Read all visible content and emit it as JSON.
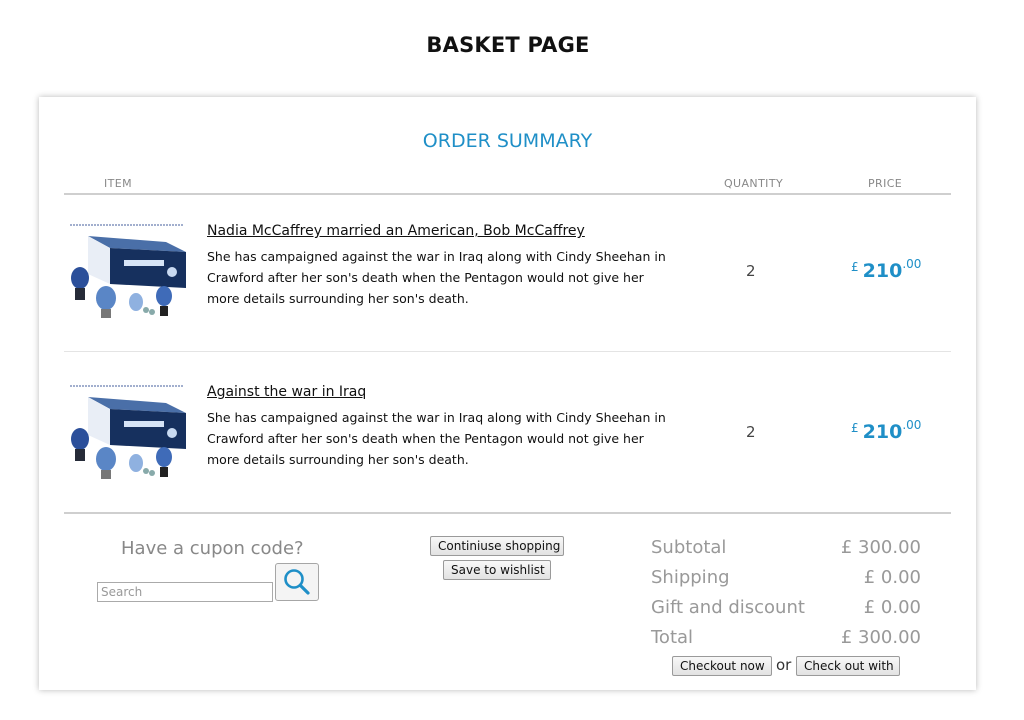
{
  "page": {
    "title": "BASKET PAGE"
  },
  "summary": {
    "title": "ORDER SUMMARY",
    "columns": {
      "item": "ITEM",
      "quantity": "QUANTITY",
      "price": "PRICE"
    }
  },
  "items": [
    {
      "title": "Nadia McCaffrey married an American, Bob McCaffrey",
      "description": "She has campaigned against the war in Iraq along with Cindy Sheehan in Crawford after her son's death when the Pentagon would not give her more details surrounding her son's death.",
      "quantity": "2",
      "currency": "£",
      "price_whole": "210",
      "price_decimal": ".00"
    },
    {
      "title": "Against the war in Iraq",
      "description": "She has campaigned against the war in Iraq along with Cindy Sheehan in Crawford after her son's death when the Pentagon would not give her more details surrounding her son's death.",
      "quantity": "2",
      "currency": "£",
      "price_whole": "210",
      "price_decimal": ".00"
    }
  ],
  "coupon": {
    "label": "Have a cupon code?",
    "placeholder": "Search",
    "button_icon": "search-icon"
  },
  "actions": {
    "continue_label": "Continiuse shopping",
    "wishlist_label": "Save to wishlist",
    "checkout_label": "Checkout now",
    "or_label": "or",
    "checkout_with_label": "Check out with"
  },
  "totals": {
    "subtotal_label": "Subtotal",
    "subtotal_value": "£ 300.00",
    "shipping_label": "Shipping",
    "shipping_value": "£ 0.00",
    "gift_label": "Gift and discount",
    "gift_value": "£ 0.00",
    "total_label": "Total",
    "total_value": "£ 300.00"
  },
  "colors": {
    "accent": "#1f8fc7",
    "muted": "#999999"
  }
}
